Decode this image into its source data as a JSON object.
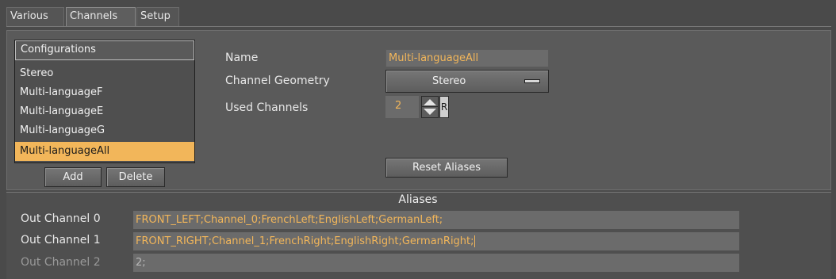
{
  "tabs": [
    {
      "label": "Various",
      "active": false
    },
    {
      "label": "Channels",
      "active": true
    },
    {
      "label": "Setup",
      "active": false
    }
  ],
  "configurations": {
    "header": "Configurations",
    "items": [
      "Stereo",
      "Multi-languageF",
      "Multi-languageE",
      "Multi-languageG",
      "Multi-languageAll"
    ],
    "selected": "Multi-languageAll",
    "add_label": "Add",
    "delete_label": "Delete"
  },
  "form": {
    "name_label": "Name",
    "name_value": "Multi-languageAll",
    "geometry_label": "Channel Geometry",
    "geometry_value": "Stereo",
    "used_channels_label": "Used Channels",
    "used_channels_value": "2",
    "reset_button_label": "R",
    "reset_aliases_label": "Reset Aliases"
  },
  "aliases": {
    "heading": "Aliases",
    "rows": [
      {
        "label": "Out Channel 0",
        "value": "FRONT_LEFT;Channel_0;FrenchLeft;EnglishLeft;GermanLeft;",
        "enabled": true
      },
      {
        "label": "Out Channel 1",
        "value": "FRONT_RIGHT;Channel_1;FrenchRight;EnglishRight;GermanRight;",
        "enabled": true
      },
      {
        "label": "Out Channel 2",
        "value": "2;",
        "enabled": false
      }
    ]
  },
  "colors": {
    "background": "#4a4a4a",
    "accent": "#f2b65a",
    "field": "#6b6b6b",
    "disabled_text": "#9a9a9a"
  },
  "icons": {
    "geometry_dropdown": "dropdown-handle-icon",
    "spinner": "spinner-up-down-icon"
  }
}
